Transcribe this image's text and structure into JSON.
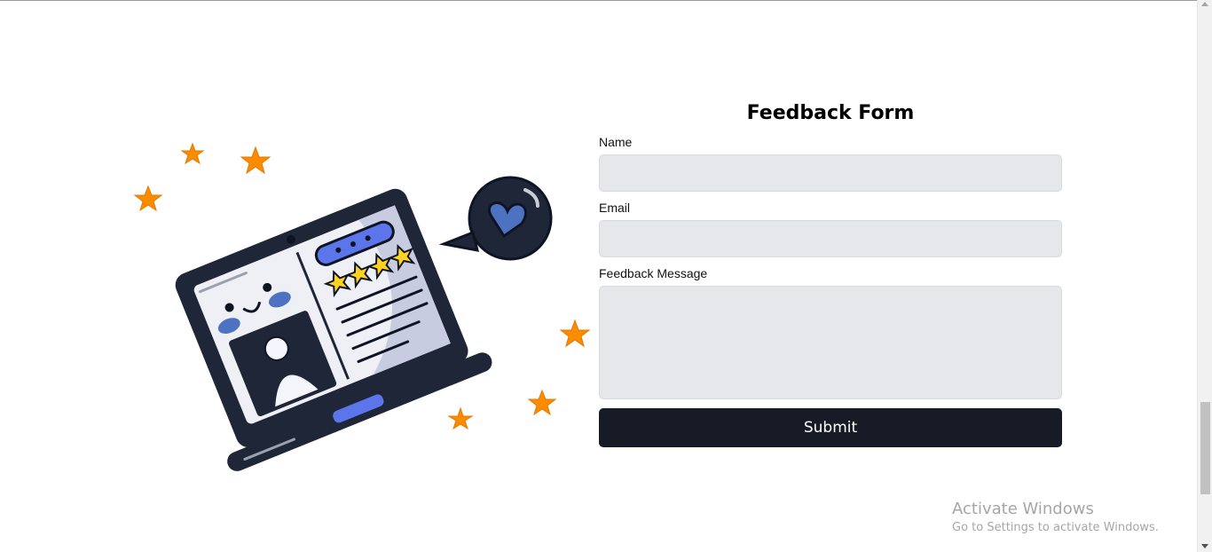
{
  "form": {
    "title": "Feedback Form",
    "name_label": "Name",
    "name_value": "",
    "email_label": "Email",
    "email_value": "",
    "message_label": "Feedback Message",
    "message_value": "",
    "submit_label": "Submit"
  },
  "watermark": {
    "title": "Activate Windows",
    "subtitle": "Go to Settings to activate Windows."
  },
  "illustration": {
    "rating_stars": 4,
    "icons": [
      "laptop-icon",
      "heart-bubble-icon",
      "star-icon",
      "profile-avatar-icon"
    ]
  },
  "colors": {
    "submit_background": "#161b26",
    "input_background": "#e5e7eb",
    "star_orange": "#fb8c00",
    "star_yellow": "#ffd21f",
    "accent_blue": "#5c75ea",
    "laptop_dark": "#1f2638"
  }
}
